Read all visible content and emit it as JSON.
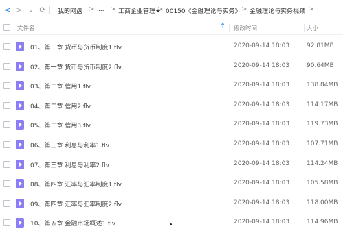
{
  "toolbar": {
    "breadcrumbs": [
      "我的网盘",
      "...",
      "工商企业管理★",
      "00150《金融理论与实务》",
      "金融理论与实务视频"
    ]
  },
  "columns": {
    "name": "文件名",
    "modified": "修改时间",
    "size": "大小"
  },
  "files": [
    {
      "name": "01、第一章 货币与货币制度1.flv",
      "modified": "2020-09-14 18:03",
      "size": "92.81MB"
    },
    {
      "name": "02、第一章 货币与货币制度2.flv",
      "modified": "2020-09-14 18:03",
      "size": "90.64MB"
    },
    {
      "name": "03、第二章 信用1.flv",
      "modified": "2020-09-14 18:03",
      "size": "138.84MB"
    },
    {
      "name": "04、第二章 信用2.flv",
      "modified": "2020-09-14 18:03",
      "size": "114.17MB"
    },
    {
      "name": "05、第二章 信用3.flv",
      "modified": "2020-09-14 18:03",
      "size": "119.73MB"
    },
    {
      "name": "06、第三章 利息与利率1.flv",
      "modified": "2020-09-14 18:03",
      "size": "107.71MB"
    },
    {
      "name": "07、第三章 利息与利率2.flv",
      "modified": "2020-09-14 18:03",
      "size": "114.24MB"
    },
    {
      "name": "08、第四章 汇率与汇率制度1.flv",
      "modified": "2020-09-14 18:03",
      "size": "105.58MB"
    },
    {
      "name": "09、第四章 汇率与汇率制度2.flv",
      "modified": "2020-09-14 18:03",
      "size": "118.00MB"
    },
    {
      "name": "10、第五章 金融市场概述1.flv",
      "modified": "2020-09-14 18:03",
      "size": "114.96MB"
    }
  ],
  "icons": {
    "file_type": "video-file-icon",
    "accent": "#1d86f0",
    "video_color": "#8b7df2"
  }
}
